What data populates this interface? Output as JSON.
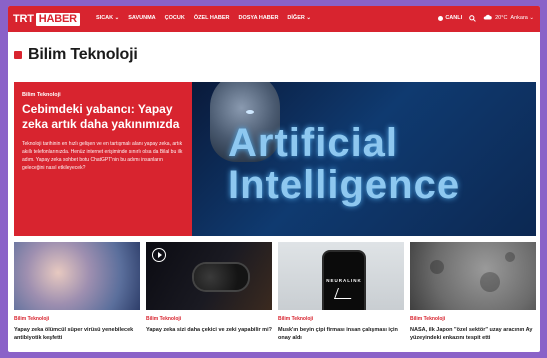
{
  "header": {
    "logo_trt": "TRT",
    "logo_haber": "HABER",
    "nav": [
      "SICAK ⌄",
      "SAVUNMA",
      "ÇOCUK",
      "ÖZEL HABER",
      "DOSYA HABER",
      "DİĞER ⌄"
    ],
    "live_label": "CANLI",
    "weather_temp": "20°C",
    "weather_city": "Ankara ⌄"
  },
  "page": {
    "section_title": "Bilim Teknoloji"
  },
  "hero": {
    "category": "Bilim Teknoloji",
    "title": "Cebimdeki yabancı: Yapay zeka artık daha yakınımızda",
    "description": "Teknoloji tarihinin en hızlı gelişen ve en tartışmalı alanı yapay zeka, artık akıllı telefonlarınızda. Henüz internet erişiminde sınırlı olsa da Bilal bu ilk adım. Yapay zeka sohbet botu ChatGPT'nin bu adımı insanların geleceğini nasıl etkileyecek?",
    "image_text_line1": "Artificial",
    "image_text_line2": "Intelligence"
  },
  "cards": [
    {
      "category": "Bilim Teknoloji",
      "title": "Yapay zeka ölümcül süper virüsü yenebilecek antibiyotik keşfetti"
    },
    {
      "category": "Bilim Teknoloji",
      "title": "Yapay zeka sizi daha çekici ve zeki yapabilir mi?"
    },
    {
      "category": "Bilim Teknoloji",
      "title": "Musk'ın beyin çipi firması insan çalışması için onay aldı",
      "image_text": "NEURALINK"
    },
    {
      "category": "Bilim Teknoloji",
      "title": "NASA, ilk Japon \"özel sektör\" uzay aracının Ay yüzeyindeki enkazını tespit etti"
    }
  ],
  "colors": {
    "brand_red": "#d8242f",
    "page_bg": "#ffffff"
  }
}
